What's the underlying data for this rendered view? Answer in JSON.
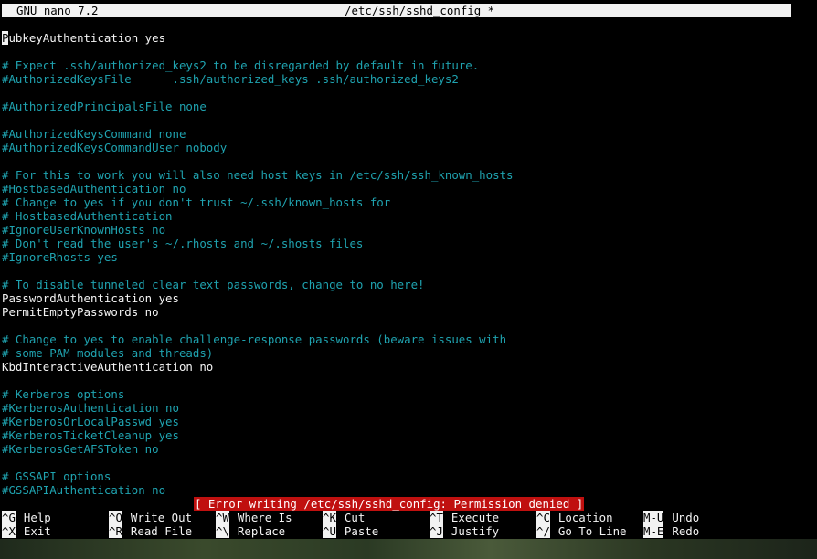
{
  "titlebar": {
    "app": "GNU nano 7.2",
    "file": "/etc/ssh/sshd_config *"
  },
  "editor": {
    "cursor_char": "P",
    "first_line_rest": "ubkeyAuthentication yes",
    "lines": [
      {
        "text": "",
        "type": "normal"
      },
      {
        "text": "# Expect .ssh/authorized_keys2 to be disregarded by default in future.",
        "type": "comment"
      },
      {
        "text": "#AuthorizedKeysFile      .ssh/authorized_keys .ssh/authorized_keys2",
        "type": "comment"
      },
      {
        "text": "",
        "type": "normal"
      },
      {
        "text": "#AuthorizedPrincipalsFile none",
        "type": "comment"
      },
      {
        "text": "",
        "type": "normal"
      },
      {
        "text": "#AuthorizedKeysCommand none",
        "type": "comment"
      },
      {
        "text": "#AuthorizedKeysCommandUser nobody",
        "type": "comment"
      },
      {
        "text": "",
        "type": "normal"
      },
      {
        "text": "# For this to work you will also need host keys in /etc/ssh/ssh_known_hosts",
        "type": "comment"
      },
      {
        "text": "#HostbasedAuthentication no",
        "type": "comment"
      },
      {
        "text": "# Change to yes if you don't trust ~/.ssh/known_hosts for",
        "type": "comment"
      },
      {
        "text": "# HostbasedAuthentication",
        "type": "comment"
      },
      {
        "text": "#IgnoreUserKnownHosts no",
        "type": "comment"
      },
      {
        "text": "# Don't read the user's ~/.rhosts and ~/.shosts files",
        "type": "comment"
      },
      {
        "text": "#IgnoreRhosts yes",
        "type": "comment"
      },
      {
        "text": "",
        "type": "normal"
      },
      {
        "text": "# To disable tunneled clear text passwords, change to no here!",
        "type": "comment"
      },
      {
        "text": "PasswordAuthentication yes",
        "type": "normal"
      },
      {
        "text": "PermitEmptyPasswords no",
        "type": "normal"
      },
      {
        "text": "",
        "type": "normal"
      },
      {
        "text": "# Change to yes to enable challenge-response passwords (beware issues with",
        "type": "comment"
      },
      {
        "text": "# some PAM modules and threads)",
        "type": "comment"
      },
      {
        "text": "KbdInteractiveAuthentication no",
        "type": "normal"
      },
      {
        "text": "",
        "type": "normal"
      },
      {
        "text": "# Kerberos options",
        "type": "comment"
      },
      {
        "text": "#KerberosAuthentication no",
        "type": "comment"
      },
      {
        "text": "#KerberosOrLocalPasswd yes",
        "type": "comment"
      },
      {
        "text": "#KerberosTicketCleanup yes",
        "type": "comment"
      },
      {
        "text": "#KerberosGetAFSToken no",
        "type": "comment"
      },
      {
        "text": "",
        "type": "normal"
      },
      {
        "text": "# GSSAPI options",
        "type": "comment"
      },
      {
        "text": "#GSSAPIAuthentication no",
        "type": "comment"
      }
    ]
  },
  "status": {
    "message": "[ Error writing /etc/ssh/sshd_config: Permission denied ]",
    "color": "#c0100f"
  },
  "shortcuts": [
    [
      {
        "key": "^G",
        "label": "Help"
      },
      {
        "key": "^O",
        "label": "Write Out"
      },
      {
        "key": "^W",
        "label": "Where Is"
      },
      {
        "key": "^K",
        "label": "Cut"
      },
      {
        "key": "^T",
        "label": "Execute"
      },
      {
        "key": "^C",
        "label": "Location"
      },
      {
        "key": "M-U",
        "label": "Undo"
      }
    ],
    [
      {
        "key": "^X",
        "label": "Exit"
      },
      {
        "key": "^R",
        "label": "Read File"
      },
      {
        "key": "^\\",
        "label": "Replace"
      },
      {
        "key": "^U",
        "label": "Paste"
      },
      {
        "key": "^J",
        "label": "Justify"
      },
      {
        "key": "^/",
        "label": "Go To Line"
      },
      {
        "key": "M-E",
        "label": "Redo"
      }
    ]
  ],
  "colors": {
    "comment": "#1fa3b0",
    "text": "#f4f4f4",
    "background": "#000000",
    "bar": "#f2f2f2"
  }
}
